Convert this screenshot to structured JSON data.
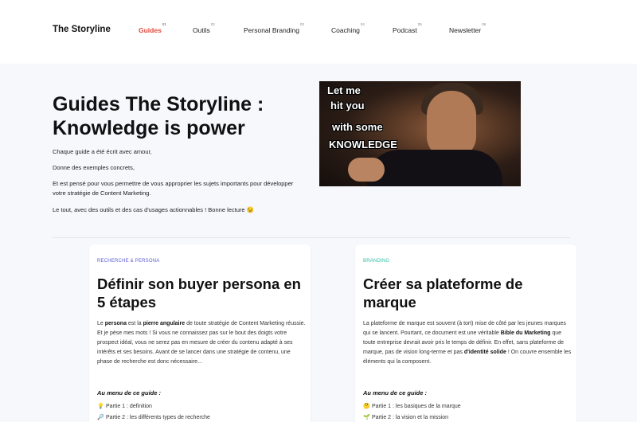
{
  "header": {
    "logo": "The Storyline",
    "nav": [
      {
        "label": "Guides",
        "num": "01"
      },
      {
        "label": "Outils",
        "num": "02"
      },
      {
        "label": "Personal Branding",
        "num": "03"
      },
      {
        "label": "Coaching",
        "num": "04"
      },
      {
        "label": "Podcast",
        "num": "05"
      },
      {
        "label": "Newsletter",
        "num": "06"
      }
    ]
  },
  "hero": {
    "title": "Guides The Storyline : Knowledge is power",
    "lines": [
      "Chaque guide a été écrit avec amour,",
      "Donne des exemples concrets,",
      "Et est pensé pour vous permettre de vous approprier les sujets importants pour développer votre stratégie de Content Marketing.",
      "Le tout, avec des outils et des cas d'usages actionnables ! Bonne lecture 😉"
    ],
    "image_text": [
      "Let me",
      "hit you",
      "with some",
      "KNOWLEDGE"
    ]
  },
  "cards": [
    {
      "tag": "RECHERCHE & PERSONA",
      "tag_color": "#5b5bd6",
      "title": "Définir son buyer persona en 5 étapes",
      "body_1": "Le ",
      "body_b1": "persona",
      "body_2": " est la ",
      "body_b2": "pierre angulaire",
      "body_3": " de toute stratégie de Content Marketing réussie. Et je pèse mes mots ! Si vous ne connaissez pas sur le bout des doigts votre prospect idéal, vous ne serez pas en mesure de créer du contenu adapté à ses intérêts et ses besoins. Avant de se lancer dans une stratégie de contenu, une phase de recherche est donc nécessaire...",
      "menu_head": "Au menu de ce guide :",
      "parts": [
        {
          "emoji": "💡",
          "text": "Partie 1 : definition"
        },
        {
          "emoji": "🔎",
          "text": "Partie 2 : les différents types de recherche"
        }
      ]
    },
    {
      "tag": "BRANDING",
      "tag_color": "#2bbfa4",
      "title": "Créer sa plateforme de marque",
      "body_1": "La plateforme de marque est souvent (à tort) mise de côté par les jeunes marques qui se lancent. Pourtant, ce document est une véritable ",
      "body_b1": "Bible du Marketing",
      "body_2": " que toute entreprise devrait avoir pris le temps de définir. En effet, sans plateforme de marque, pas de vision long-terme et pas ",
      "body_b2": "d'identité solide",
      "body_3": " ! On couvre ensemble les éléments qui la composent.",
      "menu_head": "Au menu de ce guide :",
      "parts": [
        {
          "emoji": "🤔",
          "text": "Partie 1 : les basiques de la marque"
        },
        {
          "emoji": "🌱",
          "text": "Partie 2 : la vision et la mission"
        }
      ]
    }
  ]
}
